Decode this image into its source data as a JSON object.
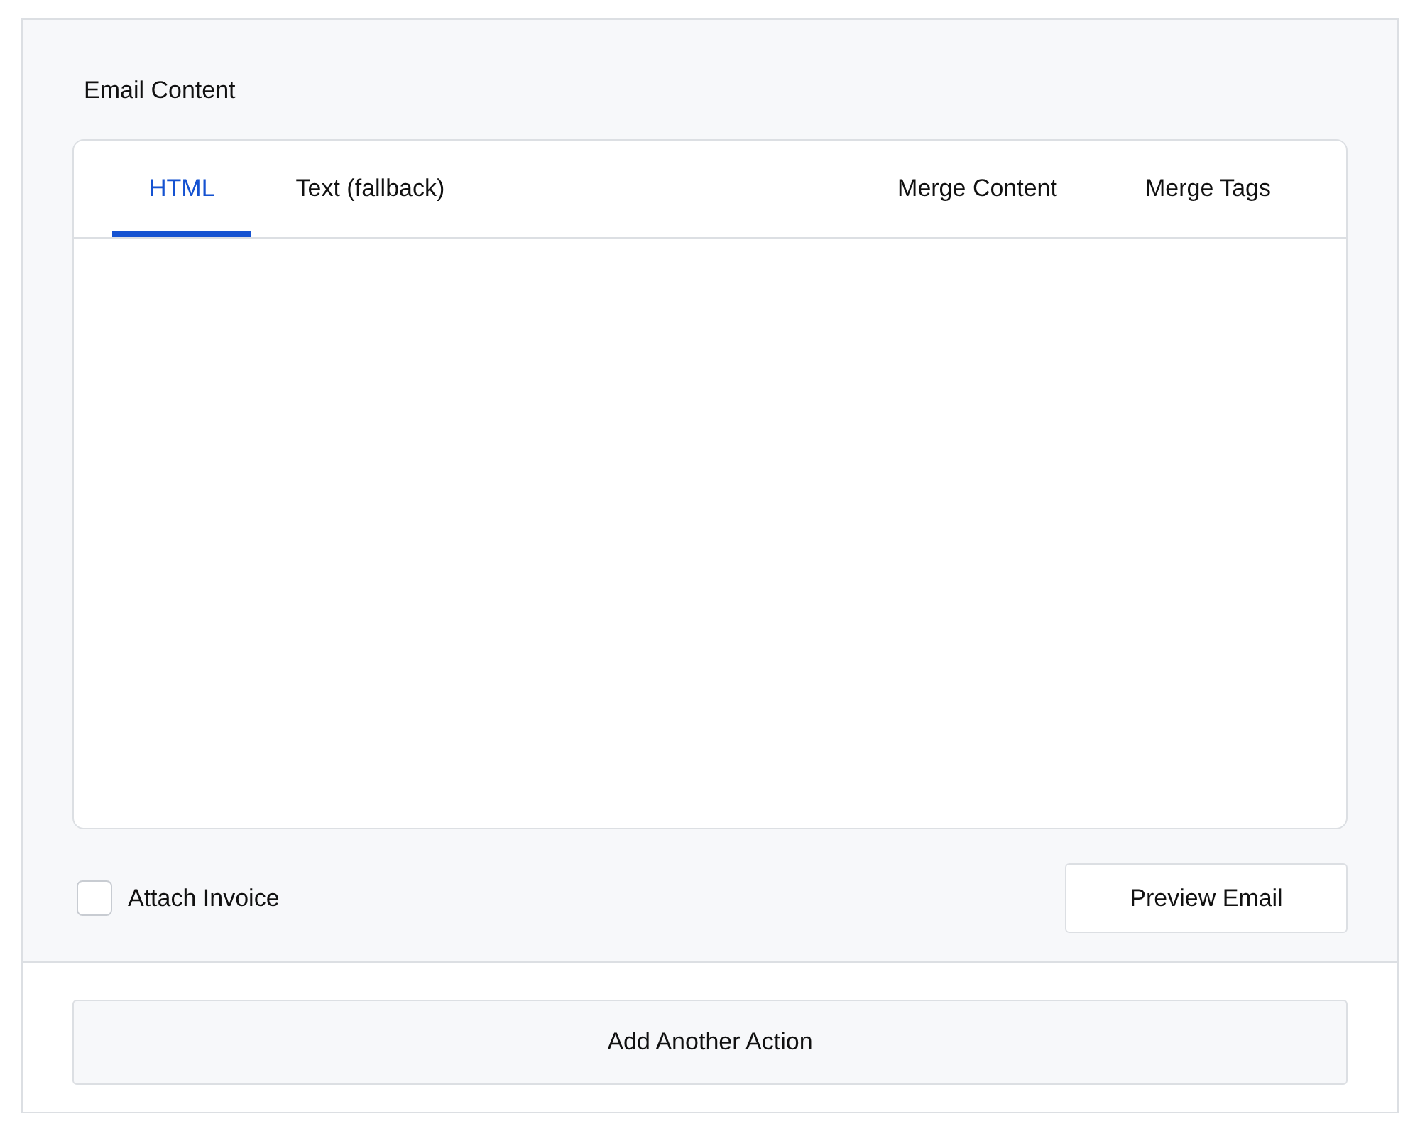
{
  "section": {
    "title": "Email Content"
  },
  "tabs": [
    {
      "label": "HTML",
      "selected": true
    },
    {
      "label": "Text (fallback)",
      "selected": false
    }
  ],
  "side_tabs": [
    {
      "label": "Merge Content",
      "selected": false
    },
    {
      "label": "Merge Tags",
      "selected": false
    }
  ],
  "attach_invoice": {
    "label": "Attach Invoice",
    "checked": false
  },
  "preview_button": "Preview Email",
  "add_action_button": "Add Another Action"
}
